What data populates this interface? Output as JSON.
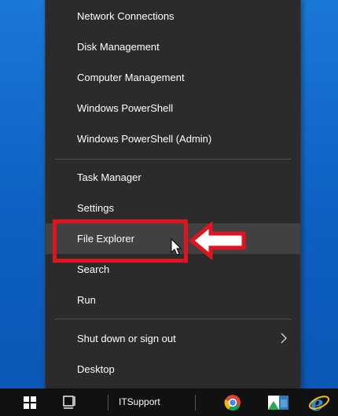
{
  "menu": {
    "items_top": [
      {
        "label": "Network Connections"
      },
      {
        "label": "Disk Management"
      },
      {
        "label": "Computer Management"
      },
      {
        "label": "Windows PowerShell"
      },
      {
        "label": "Windows PowerShell (Admin)"
      }
    ],
    "items_mid": [
      {
        "label": "Task Manager"
      },
      {
        "label": "Settings"
      },
      {
        "label": "File Explorer"
      },
      {
        "label": "Search"
      },
      {
        "label": "Run"
      }
    ],
    "items_bottom": [
      {
        "label": "Shut down or sign out"
      },
      {
        "label": "Desktop"
      }
    ]
  },
  "taskbar": {
    "window_label": "ITSupport",
    "icons": [
      "windows-start-icon",
      "task-view-icon",
      "chrome-icon",
      "store-icon",
      "internet-explorer-icon"
    ]
  },
  "annotation": {
    "highlight_color": "#e0141e"
  }
}
